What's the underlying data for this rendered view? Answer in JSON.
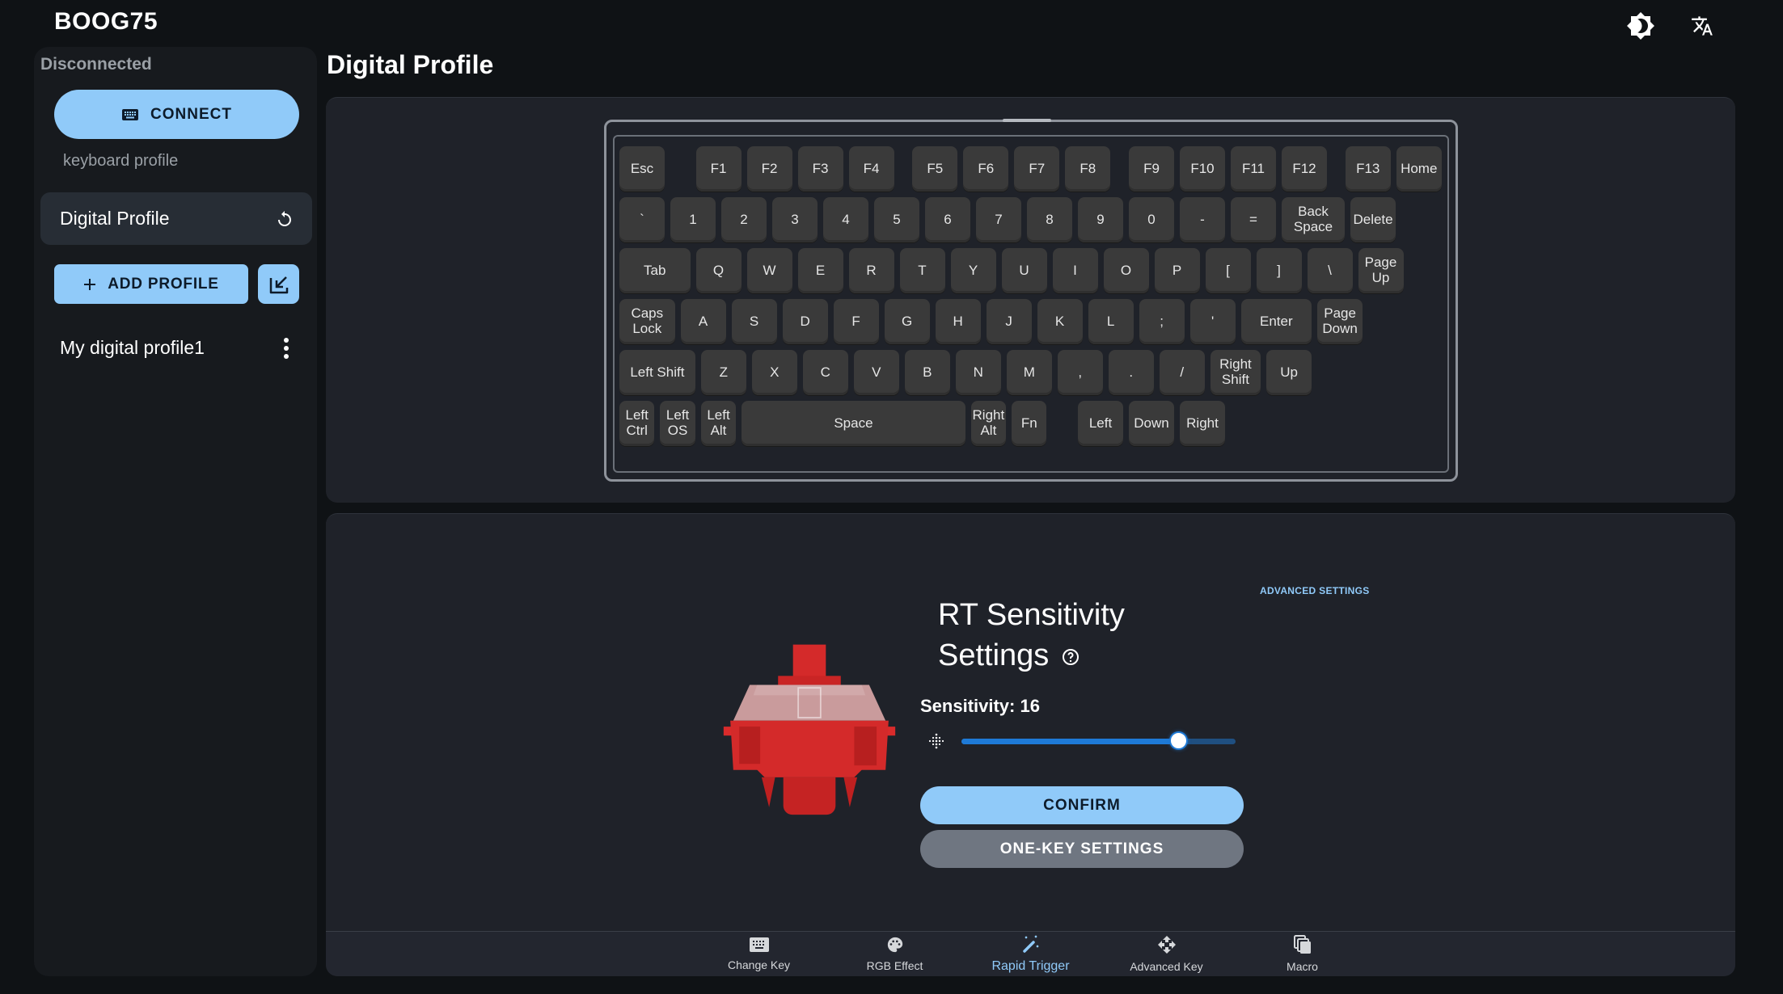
{
  "app": {
    "title": "BOOG75",
    "icons": [
      "brightness-icon",
      "translate-icon"
    ]
  },
  "sidebar": {
    "status": "Disconnected",
    "connect_label": "CONNECT",
    "section_label": "keyboard profile",
    "active_profile": "Digital Profile",
    "add_profile_label": "ADD PROFILE",
    "profiles": [
      {
        "label": "My digital profile1"
      }
    ]
  },
  "main": {
    "title": "Digital Profile",
    "keyboard": {
      "rows": [
        [
          "Esc",
          "F1",
          "F2",
          "F3",
          "F4",
          "F5",
          "F6",
          "F7",
          "F8",
          "F9",
          "F10",
          "F11",
          "F12",
          "F13",
          "Home"
        ],
        [
          "`",
          "1",
          "2",
          "3",
          "4",
          "5",
          "6",
          "7",
          "8",
          "9",
          "0",
          "-",
          "=",
          "Back Space",
          "Delete"
        ],
        [
          "Tab",
          "Q",
          "W",
          "E",
          "R",
          "T",
          "Y",
          "U",
          "I",
          "O",
          "P",
          "[",
          "]",
          "\\",
          "Page\nUp"
        ],
        [
          "Caps\nLock",
          "A",
          "S",
          "D",
          "F",
          "G",
          "H",
          "J",
          "K",
          "L",
          ";",
          "'",
          "Enter",
          "Page\nDown"
        ],
        [
          "Left Shift",
          "Z",
          "X",
          "C",
          "V",
          "B",
          "N",
          "M",
          ",",
          ".",
          "/",
          "Right Shift",
          "Up"
        ],
        [
          "Left\nCtrl",
          "Left\nOS",
          "Left\nAlt",
          "Space",
          "Right\nAlt",
          "Fn",
          "Left",
          "Down",
          "Right"
        ]
      ]
    },
    "rt": {
      "title": "RT Sensitivity Settings",
      "advanced_settings_label": "ADVANCED SETTINGS",
      "sensitivity_label": "Sensitivity: 16",
      "sensitivity_value": 16,
      "sensitivity_fraction": 0.79,
      "confirm_label": "CONFIRM",
      "one_key_label": "ONE-KEY SETTINGS"
    },
    "bottom_nav": [
      {
        "label": "Change Key",
        "icon": "keyboard-icon",
        "active": false
      },
      {
        "label": "RGB Effect",
        "icon": "palette-icon",
        "active": false
      },
      {
        "label": "Rapid Trigger",
        "icon": "magic-wand-icon",
        "active": true
      },
      {
        "label": "Advanced Key",
        "icon": "move-icon",
        "active": false
      },
      {
        "label": "Macro",
        "icon": "copy-icon",
        "active": false
      }
    ]
  },
  "colors": {
    "accent": "#90caf9",
    "slider_fill": "#1e7ad6",
    "background": "#0f1215",
    "panel": "#1f2229"
  }
}
